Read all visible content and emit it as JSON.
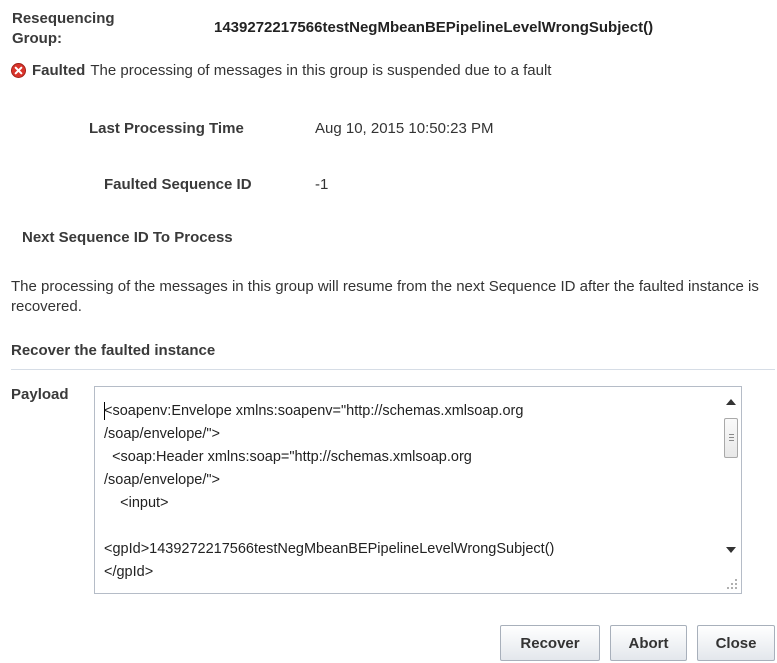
{
  "group": {
    "label_line1": "Resequencing",
    "label_line2": "Group:",
    "value": "1439272217566testNegMbeanBEPipelineLevelWrongSubject()"
  },
  "status": {
    "icon": "error-icon",
    "word": "Faulted",
    "message": "The processing of messages in this group is suspended due to a fault"
  },
  "details": {
    "last_processing_time_label": "Last Processing Time",
    "last_processing_time_value": "Aug 10, 2015 10:50:23 PM",
    "faulted_sequence_label": "Faulted Sequence ID",
    "faulted_sequence_value": "-1",
    "next_sequence_label": "Next Sequence ID To Process",
    "next_sequence_value": ""
  },
  "resume_message": "The processing of the messages in this group will resume from the next Sequence ID after the faulted instance is recovered.",
  "recover": {
    "section_title": "Recover the faulted instance",
    "payload_label": "Payload",
    "payload_text": "<soapenv:Envelope xmlns:soapenv=\"http://schemas.xmlsoap.org\n/soap/envelope/\">\n  <soap:Header xmlns:soap=\"http://schemas.xmlsoap.org\n/soap/envelope/\">\n    <input>\n\n<gpId>1439272217566testNegMbeanBEPipelineLevelWrongSubject()\n</gpId>"
  },
  "buttons": {
    "recover": "Recover",
    "abort": "Abort",
    "close": "Close"
  },
  "colors": {
    "error_icon": "#d9342b",
    "divider": "#d6dde6",
    "button_border": "#a8b0bb"
  }
}
